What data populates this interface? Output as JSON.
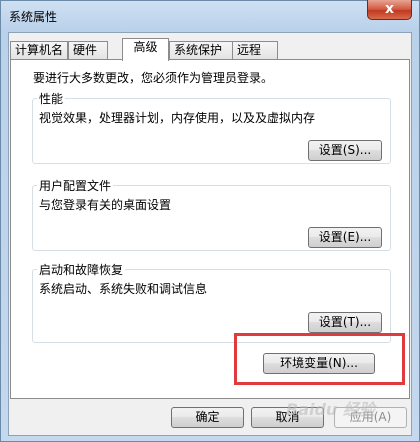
{
  "window": {
    "title": "系统属性",
    "close_glyph": "x"
  },
  "tabs": [
    {
      "label": "计算机名",
      "active": false
    },
    {
      "label": "硬件",
      "active": false
    },
    {
      "label": "高级",
      "active": true
    },
    {
      "label": "系统保护",
      "active": false
    },
    {
      "label": "远程",
      "active": false
    }
  ],
  "notice": "要进行大多数更改，您必须作为管理员登录。",
  "performance": {
    "legend": "性能",
    "description": "视觉效果，处理器计划，内存使用，以及及虚拟内存",
    "button": "设置(S)..."
  },
  "profiles": {
    "legend": "用户配置文件",
    "description": "与您登录有关的桌面设置",
    "button": "设置(E)..."
  },
  "startup": {
    "legend": "启动和故障恢复",
    "description": "系统启动、系统失败和调试信息",
    "button": "设置(T)..."
  },
  "env_button": "环境变量(N)...",
  "footer": {
    "ok": "确定",
    "cancel": "取消",
    "apply": "应用(A)"
  },
  "watermark": "Baidu 经验",
  "colors": {
    "highlight_box": "#e0393e",
    "close_button": "#c0391f"
  }
}
